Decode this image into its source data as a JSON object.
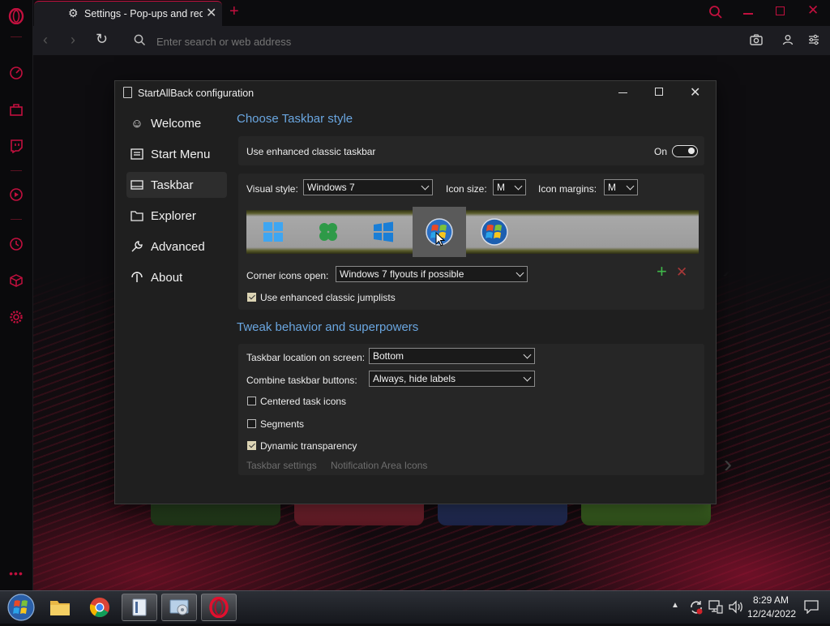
{
  "browser": {
    "tab_title": "Settings - Pop-ups and red",
    "address_placeholder": "Enter search or web address"
  },
  "dialog": {
    "title": "StartAllBack configuration",
    "nav": [
      {
        "label": "Welcome",
        "icon": "smile-icon"
      },
      {
        "label": "Start Menu",
        "icon": "start-menu-icon"
      },
      {
        "label": "Taskbar",
        "icon": "taskbar-icon",
        "selected": true
      },
      {
        "label": "Explorer",
        "icon": "folder-icon"
      },
      {
        "label": "Advanced",
        "icon": "wrench-icon"
      },
      {
        "label": "About",
        "icon": "about-icon"
      }
    ],
    "section1_title": "Choose Taskbar style",
    "enhanced_label": "Use enhanced classic taskbar",
    "toggle_label": "On",
    "visual_style_label": "Visual style:",
    "visual_style_value": "Windows 7",
    "icon_size_label": "Icon size:",
    "icon_size_value": "M",
    "icon_margins_label": "Icon margins:",
    "icon_margins_value": "M",
    "corner_icons_label": "Corner icons open:",
    "corner_icons_value": "Windows 7 flyouts if possible",
    "jumplists_label": "Use enhanced classic jumplists",
    "section2_title": "Tweak behavior and superpowers",
    "location_label": "Taskbar location on screen:",
    "location_value": "Bottom",
    "combine_label": "Combine taskbar buttons:",
    "combine_value": "Always, hide labels",
    "centered_label": "Centered task icons",
    "segments_label": "Segments",
    "dynamic_label": "Dynamic transparency",
    "link_taskbar_settings": "Taskbar settings",
    "link_notification": "Notification Area Icons"
  },
  "taskbar": {
    "time": "8:29 AM",
    "date": "12/24/2022"
  },
  "colors": {
    "accent": "#c2103e",
    "link_blue": "#6aa6e0"
  }
}
